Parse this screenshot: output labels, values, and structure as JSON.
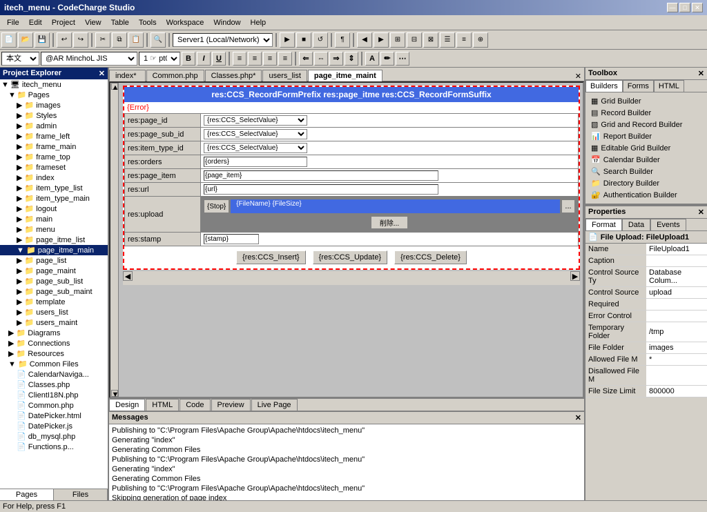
{
  "window": {
    "title": "itech_menu - CodeCharge Studio",
    "min_btn": "—",
    "max_btn": "□",
    "close_btn": "✕"
  },
  "menu": {
    "items": [
      "File",
      "Edit",
      "Project",
      "View",
      "Table",
      "Tools",
      "Workspace",
      "Window",
      "Help"
    ]
  },
  "toolbar": {
    "server_dropdown": "Server1 (Local/Network)"
  },
  "font_bar": {
    "style": "本文",
    "name": "@AR MinchoL JIS",
    "size": "1 ☞ pt0"
  },
  "tabs": {
    "items": [
      "index*",
      "Common.php",
      "Classes.php*",
      "users_list",
      "page_itme_maint"
    ]
  },
  "project_explorer": {
    "title": "Project Explorer",
    "root": "itech_menu",
    "pages": "Pages",
    "items": [
      "images",
      "Styles",
      "admin",
      "frame_left",
      "frame_main",
      "frame_top",
      "frameset",
      "index",
      "item_type_list",
      "item_type_main",
      "logout",
      "main",
      "menu",
      "page_itme_list",
      "page_itme_main",
      "page_list",
      "page_maint",
      "page_sub_list",
      "page_sub_maint",
      "template",
      "users_list",
      "users_maint"
    ],
    "diagrams": "Diagrams",
    "connections": "Connections",
    "resources": "Resources",
    "common_files": "Common Files",
    "common_items": [
      "CalendarNaviga...",
      "Classes.php",
      "ClientI18N.php",
      "Common.php",
      "DatePicker.html",
      "DatePicker.js",
      "db_mysql.php",
      "Functions.p..."
    ]
  },
  "form": {
    "header": "res:CCS_RecordFormPrefix res:page_itme res:CCS_RecordFormSuffix",
    "error": "{Error}",
    "fields": [
      {
        "label": "res:page_id",
        "type": "select",
        "value": "{res:CCS_SelectValue}"
      },
      {
        "label": "res:page_sub_id",
        "type": "select",
        "value": "{res:CCS_SelectValue}"
      },
      {
        "label": "res:item_type_id",
        "type": "select",
        "value": "{res:CCS_SelectValue}"
      },
      {
        "label": "res:orders",
        "type": "text",
        "value": "{orders}"
      },
      {
        "label": "res:page_item",
        "type": "text",
        "value": "{page_item}"
      },
      {
        "label": "res:url",
        "type": "text",
        "value": "{url}"
      },
      {
        "label": "res:upload",
        "type": "upload",
        "stop": "{Stop}",
        "info": "{FileName} {FileSize}",
        "btn": "削除..."
      },
      {
        "label": "res:stamp",
        "type": "text",
        "value": "{stamp}"
      }
    ],
    "buttons": [
      "{res:CCS_Insert}",
      "{res:CCS_Update}",
      "{res:CCS_Delete}"
    ]
  },
  "bottom_tabs": [
    "Design",
    "HTML",
    "Code",
    "Preview",
    "Live Page"
  ],
  "messages": {
    "title": "Messages",
    "lines": [
      "Publishing to \"C:\\Program Files\\Apache Group\\Apache\\htdocs\\itech_menu\"",
      "Generating \"index\"",
      "Generating Common Files",
      "Publishing to \"C:\\Program Files\\Apache Group\\Apache\\htdocs\\itech_menu\"",
      "Generating \"index\"",
      "Generating Common Files",
      "Publishing to \"C:\\Program Files\\Apache Group\\Apache\\htdocs\\itech_menu\"",
      "Skipping generation of page index"
    ]
  },
  "toolbox": {
    "title": "Toolbox",
    "tabs": [
      "Builders",
      "Forms",
      "HTML"
    ],
    "builders": [
      "Grid Builder",
      "Record Builder",
      "Grid and Record Builder",
      "Report Builder",
      "Editable Grid Builder",
      "Calendar Builder",
      "Search Builder",
      "Directory Builder",
      "Authentication Builder"
    ]
  },
  "properties": {
    "title": "Properties",
    "tabs": [
      "Format",
      "Data",
      "Events"
    ],
    "object_title": "File Upload: FileUpload1",
    "rows": [
      {
        "label": "Name",
        "value": "FileUpload1"
      },
      {
        "label": "Caption",
        "value": ""
      },
      {
        "label": "Control Source Ty",
        "value": "Database Colum..."
      },
      {
        "label": "Control Source",
        "value": "upload"
      },
      {
        "label": "Required",
        "value": ""
      },
      {
        "label": "Error Control",
        "value": ""
      },
      {
        "label": "Temporary Folder",
        "value": "/tmp"
      },
      {
        "label": "File Folder",
        "value": "images"
      },
      {
        "label": "Allowed File M",
        "value": "*"
      },
      {
        "label": "Disallowed File M",
        "value": ""
      },
      {
        "label": "File Size Limit",
        "value": "800000"
      }
    ]
  },
  "status_bar": {
    "text": "For Help, press F1"
  },
  "panel_footer": [
    "Pages",
    "Files"
  ],
  "icons": {
    "folder": "📁",
    "page": "📄",
    "grid": "▦",
    "builder": "🔧",
    "file": "📄"
  }
}
